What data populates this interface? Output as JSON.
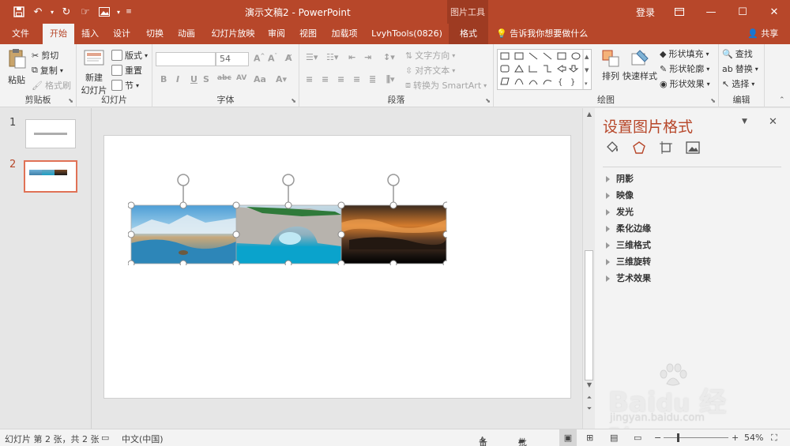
{
  "titlebar": {
    "title": "演示文稿2  -  PowerPoint",
    "context_group": "图片工具",
    "login": "登录",
    "qat_icons": [
      "save-icon",
      "undo-icon",
      "redo-icon",
      "touch-icon",
      "picture-icon",
      "customize-icon"
    ]
  },
  "tabs": [
    {
      "label": "文件"
    },
    {
      "label": "开始"
    },
    {
      "label": "插入"
    },
    {
      "label": "设计"
    },
    {
      "label": "切换"
    },
    {
      "label": "动画"
    },
    {
      "label": "幻灯片放映"
    },
    {
      "label": "审阅"
    },
    {
      "label": "视图"
    },
    {
      "label": "加载项"
    },
    {
      "label": "LvyhTools(0826)"
    },
    {
      "label": "格式"
    }
  ],
  "tellme": "告诉我你想要做什么",
  "share": "共享",
  "ribbon": {
    "clipboard": {
      "label": "剪贴板",
      "paste": "粘贴",
      "cut": "剪切",
      "copy": "复制",
      "format_painter": "格式刷"
    },
    "slides": {
      "label": "幻灯片",
      "new_slide": "新建",
      "new_slide2": "幻灯片",
      "layout": "版式",
      "reset": "重置",
      "section": "节"
    },
    "font": {
      "label": "字体",
      "font_name": "",
      "font_size": "54"
    },
    "paragraph": {
      "label": "段落",
      "text_direction": "文字方向",
      "align_text": "对齐文本",
      "smartart": "转换为 SmartArt"
    },
    "drawing": {
      "label": "绘图",
      "arrange": "排列",
      "quick_styles": "快速样式",
      "shape_fill": "形状填充",
      "shape_outline": "形状轮廓",
      "shape_effects": "形状效果"
    },
    "editing": {
      "label": "编辑",
      "find": "查找",
      "replace": "替换",
      "select": "选择"
    }
  },
  "thumbnails": [
    {
      "number": "1"
    },
    {
      "number": "2"
    }
  ],
  "pane": {
    "title": "设置图片格式",
    "items": [
      "阴影",
      "映像",
      "发光",
      "柔化边缘",
      "三维格式",
      "三维旋转",
      "艺术效果"
    ]
  },
  "status": {
    "slide_info": "幻灯片 第 2 张，共 2 张",
    "language": "中文(中国)",
    "notes": "备注",
    "comments": "批注",
    "zoom": "54%"
  },
  "watermark": {
    "brand": "Bai",
    "brand2": "经验",
    "url": "jingyan.baidu.com"
  },
  "colors": {
    "accent": "#b7472a",
    "context_tab": "#9e3b22"
  }
}
